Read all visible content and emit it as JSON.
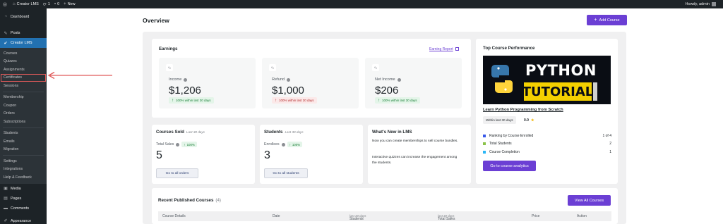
{
  "adminbar": {
    "site_name": "Creator LMS",
    "updates_count": "1",
    "comments_count": "0",
    "new_label": "New",
    "howdy": "Howdy, admin"
  },
  "sidebar": {
    "dashboard": "Dashboard",
    "posts": "Posts",
    "creator_lms": "Creator LMS",
    "submenu_group1": [
      "Courses",
      "Quizzes",
      "Assignments",
      "Certificates",
      "Sessions"
    ],
    "submenu_group2": [
      "Membership",
      "Coupon",
      "Orders",
      "Subscriptions"
    ],
    "submenu_group3": [
      "Students",
      "Emails",
      "Migration"
    ],
    "submenu_group4": [
      "Settings",
      "Integrations",
      "Help & Feedback"
    ],
    "media": "Media",
    "pages": "Pages",
    "comments": "Comments",
    "appearance": "Appearance"
  },
  "header": {
    "title": "Overview",
    "add_course": "Add Course"
  },
  "earnings": {
    "title": "Earnings",
    "report_link": "Earning Report",
    "stats": [
      {
        "label": "Income",
        "value": "$1,206",
        "change": "100% within last 30 days",
        "direction": "up"
      },
      {
        "label": "Refund",
        "value": "$1,000",
        "change": "100% within last 30 days",
        "direction": "down"
      },
      {
        "label": "Net Income",
        "value": "$206",
        "change": "100% within last 30 days",
        "direction": "up"
      }
    ]
  },
  "courses_sold": {
    "title": "Courses Sold",
    "period": "Last 30 days",
    "metric_label": "Total Sales",
    "badge": "100%",
    "value": "5",
    "button": "Go to all orders"
  },
  "students": {
    "title": "Students",
    "period": "Last 30 days",
    "metric_label": "Enrollees",
    "badge": "100%",
    "value": "3",
    "button": "Go to all students"
  },
  "whats_new": {
    "title": "What's New in LMS",
    "p1": "Now you can create memberships to sell course bundles.",
    "p2": "Interactive quizzes can increase the engagement among the students."
  },
  "top_course": {
    "title": "Top Course Performance",
    "image_title": "PYTHON",
    "image_banner": "TUTORIAL",
    "course_name": "Learn Python Programming from Scratch",
    "range": "Within last 30 days",
    "rating": "0.0",
    "rows": [
      {
        "label": "Ranking by Course Enrolled",
        "value": "1 of 4",
        "color": "#3858e9"
      },
      {
        "label": "Total Students",
        "value": "2",
        "color": "#8bc34a"
      },
      {
        "label": "Course Completion",
        "value": "1",
        "color": "#29b6f6"
      }
    ],
    "button": "Go to course analytics"
  },
  "recent": {
    "title": "Recent Published Courses",
    "count": "(4)",
    "view_all": "View All Courses",
    "columns": {
      "details": "Course Details",
      "date": "Date",
      "students": "Students",
      "students_period": "last 30 days",
      "sales": "Total Sales",
      "sales_period": "last 30 days",
      "price": "Price",
      "action": "Action"
    }
  },
  "colors": {
    "accent": "#6b3fd4",
    "wp_blue": "#2271b1",
    "sidebar_bg": "#1d2327",
    "highlight": "#e05a5a"
  }
}
